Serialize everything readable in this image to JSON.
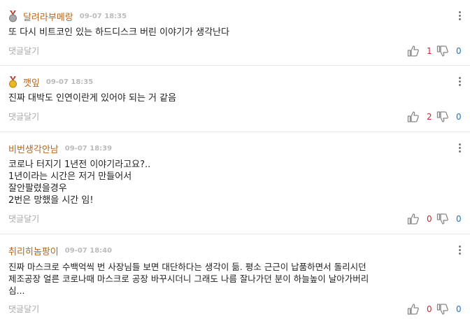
{
  "reply_label": "댓글달기",
  "comments": [
    {
      "nickname": "달려라부메랑",
      "time": "09-07 18:35",
      "medal": "silver-medal-icon",
      "text": "또 다시 비트코인 있는 하드디스크 버린 이야기가 생각난다",
      "likes": "1",
      "dislikes": "0"
    },
    {
      "nickname": "깻잎",
      "time": "09-07 18:35",
      "medal": "gold-medal-icon",
      "text": "진짜 대박도 인연이란게 있어야 되는 거 같음",
      "likes": "2",
      "dislikes": "0"
    },
    {
      "nickname": "비번생각안남",
      "time": "09-07 18:39",
      "medal": "",
      "text": "코로나 터지기 1년전 이야기라고요?..\n1년이라는 시간은 저거 만들어서\n잘안팔렸을경우\n2번은 망했을 시간 임!",
      "likes": "0",
      "dislikes": "0"
    },
    {
      "nickname": "취리히놈팡이",
      "time": "09-07 18:40",
      "medal": "",
      "text": "진짜 마스크로 수백억씩 번 사장님들 보면 대단하다는 생각이 듦. 평소 근근이 납품하면서 돌리시던\n제조공장 얼른 코로나때 마스크로 공장 바꾸시더니 그래도 나름 잘나가던 분이 하늘높이 날아가버리\n심...",
      "likes": "0",
      "dislikes": "0"
    }
  ],
  "colors": {
    "nickname": "#b5651d",
    "like": "#d0282e",
    "dislike": "#1a73c7"
  }
}
